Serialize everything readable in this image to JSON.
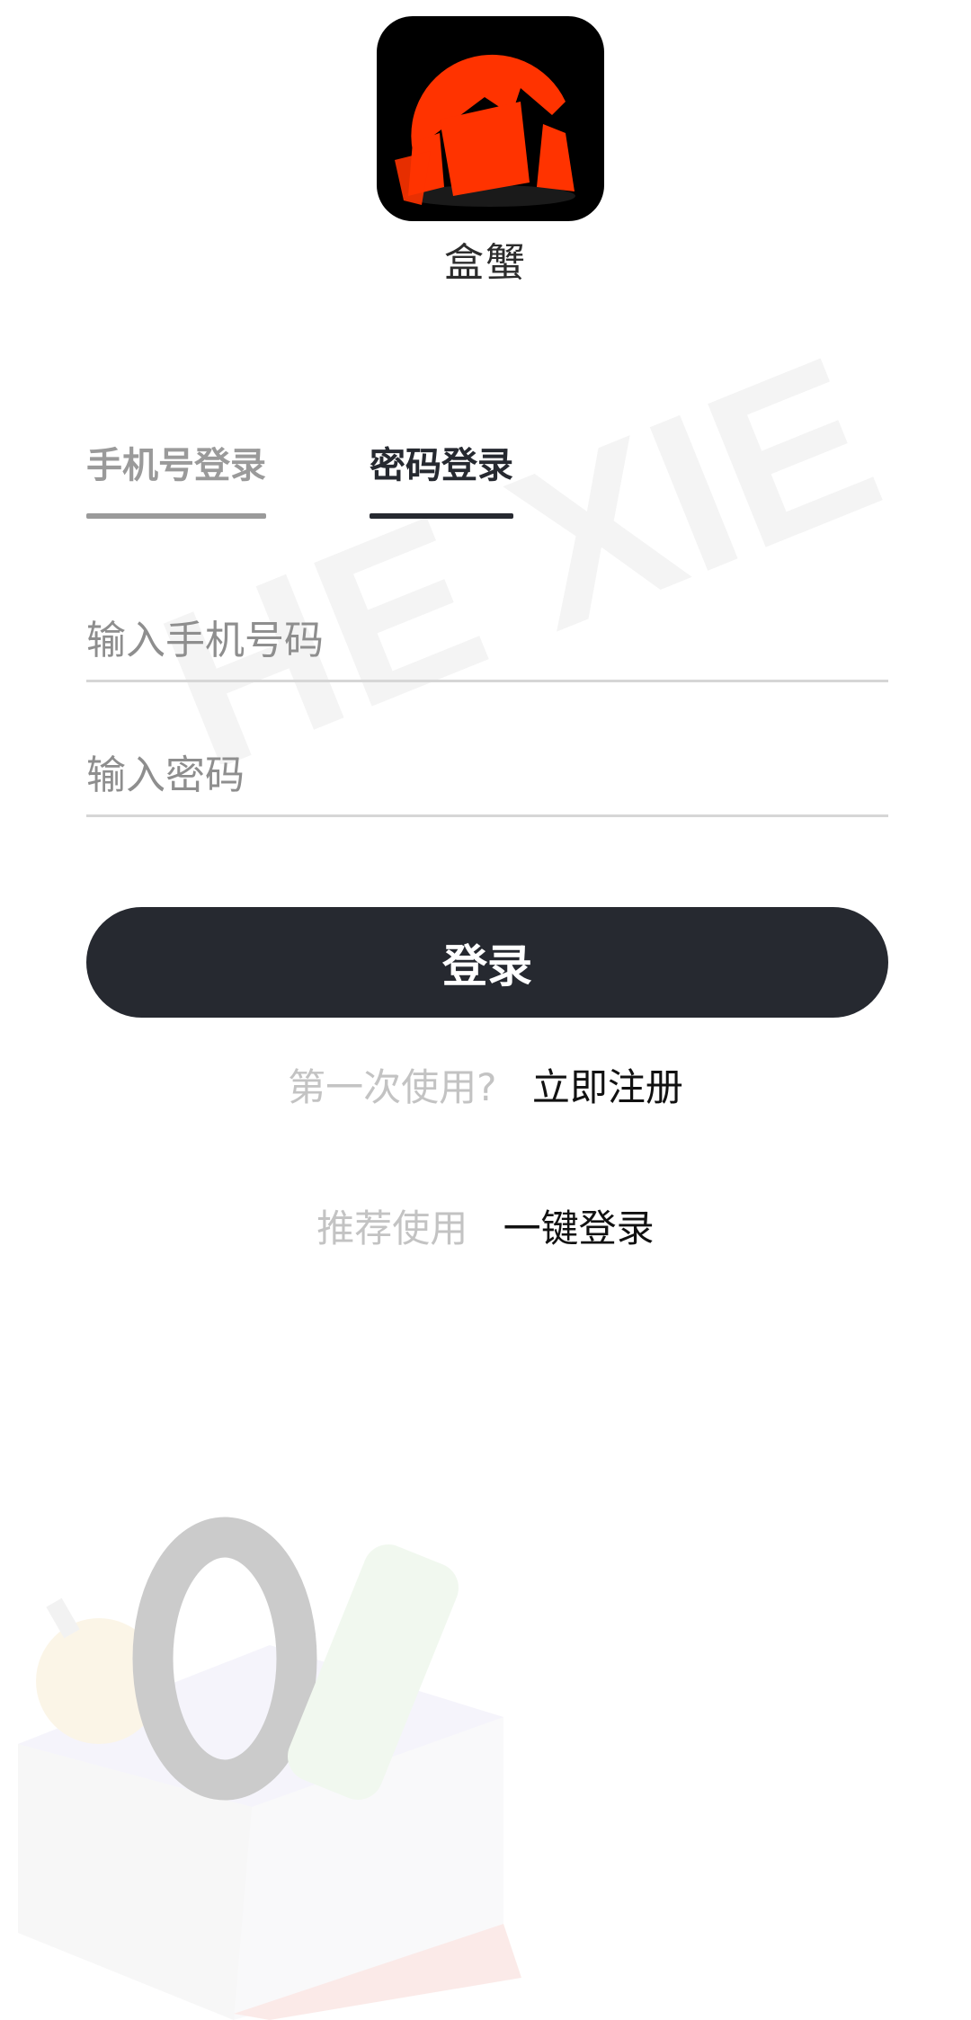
{
  "app": {
    "name": "盒蟹",
    "watermark_text": "HE XIE"
  },
  "tabs": [
    {
      "label": "手机号登录",
      "active": false
    },
    {
      "label": "密码登录",
      "active": true
    }
  ],
  "form": {
    "phone_placeholder": "输入手机号码",
    "phone_value": "",
    "password_placeholder": "输入密码",
    "password_value": "",
    "login_label": "登录"
  },
  "register": {
    "prompt": "第一次使用?",
    "link": "立即注册"
  },
  "one_key": {
    "prompt": "推荐使用",
    "link": "一键登录"
  },
  "colors": {
    "primary": "#262930",
    "logo_red": "#ff3300",
    "muted": "#c3c3c3"
  },
  "icons": {
    "logo": "crab-box-logo"
  }
}
